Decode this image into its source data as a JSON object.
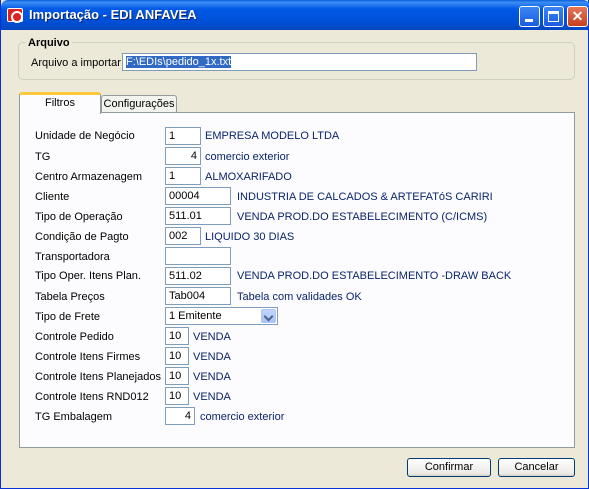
{
  "window": {
    "title": "Importação - EDI ANFAVEA",
    "close_glyph": "✕"
  },
  "arquivo": {
    "legend": "Arquivo",
    "label": "Arquivo a importar",
    "value": "F:\\EDIs\\pedido_1x.txt"
  },
  "tabs": [
    {
      "label": "Filtros",
      "active": true
    },
    {
      "label": "Configurações",
      "active": false
    }
  ],
  "form": {
    "unidade": {
      "label": "Unidade de Negócio",
      "value": "1",
      "desc": "EMPRESA MODELO LTDA"
    },
    "tg": {
      "label": "TG",
      "value": "4",
      "desc": "comercio exterior"
    },
    "centro": {
      "label": "Centro Armazenagem",
      "value": "1",
      "desc": "ALMOXARIFADO"
    },
    "cliente": {
      "label": "Cliente",
      "value": "00004",
      "desc": "INDUSTRIA DE CALCADOS & ARTEFATóS CARIRI"
    },
    "tipo_operacao": {
      "label": "Tipo de Operação",
      "value": "511.01",
      "desc": "VENDA PROD.DO ESTABELECIMENTO (C/ICMS)"
    },
    "condicao": {
      "label": "Condição de Pagto",
      "value": "002",
      "desc": "LIQUIDO 30 DIAS"
    },
    "transportadora": {
      "label": "Transportadora",
      "value": "",
      "desc": ""
    },
    "tipo_oper_itens": {
      "label": "Tipo Oper. Itens Plan.",
      "value": "511.02",
      "desc": "VENDA PROD.DO ESTABELECIMENTO -DRAW BACK"
    },
    "tabela_precos": {
      "label": "Tabela Preços",
      "value": "Tab004",
      "desc": "Tabela com validades OK"
    },
    "tipo_frete": {
      "label": "Tipo de Frete",
      "value": "1 Emitente"
    },
    "controle_pedido": {
      "label": "Controle Pedido",
      "value": "10",
      "desc": "VENDA"
    },
    "controle_firmes": {
      "label": "Controle Itens Firmes",
      "value": "10",
      "desc": "VENDA"
    },
    "controle_planejados": {
      "label": "Controle Itens Planejados",
      "value": "10",
      "desc": "VENDA"
    },
    "controle_rnd": {
      "label": "Controle Itens RND012",
      "value": "10",
      "desc": "VENDA"
    },
    "tg_embalagem": {
      "label": "TG Embalagem",
      "value": "4",
      "desc": "comercio exterior"
    }
  },
  "buttons": {
    "confirm": "Confirmar",
    "cancel": "Cancelar"
  },
  "colors": {
    "title_bar": "#0054e3",
    "accent_tab": "#ffc83c",
    "description_text": "#0a246a"
  }
}
